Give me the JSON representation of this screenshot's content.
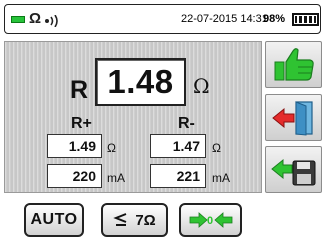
{
  "status_bar": {
    "mode_symbol": "Ω",
    "datetime": "22-07-2015 14:31",
    "battery_percent": "98%"
  },
  "measurement": {
    "main_label": "R",
    "main_value": "1.48",
    "main_unit": "Ω",
    "r_plus": {
      "label": "R+",
      "resistance": "1.49",
      "resistance_unit": "Ω",
      "current": "220",
      "current_unit": "mA"
    },
    "r_minus": {
      "label": "R-",
      "resistance": "1.47",
      "resistance_unit": "Ω",
      "current": "221",
      "current_unit": "mA"
    }
  },
  "side_buttons": [
    {
      "icon": "thumbs-up-icon"
    },
    {
      "icon": "exit-door-icon"
    },
    {
      "icon": "save-to-disk-icon"
    }
  ],
  "bottom_buttons": {
    "auto_label": "AUTO",
    "range_label": "7Ω",
    "zero_icon": "zero-calibration-icon"
  },
  "colors": {
    "accent_green": "#2fc332",
    "accent_red": "#e42b2b",
    "panel_gray": "#d0d0d0"
  }
}
